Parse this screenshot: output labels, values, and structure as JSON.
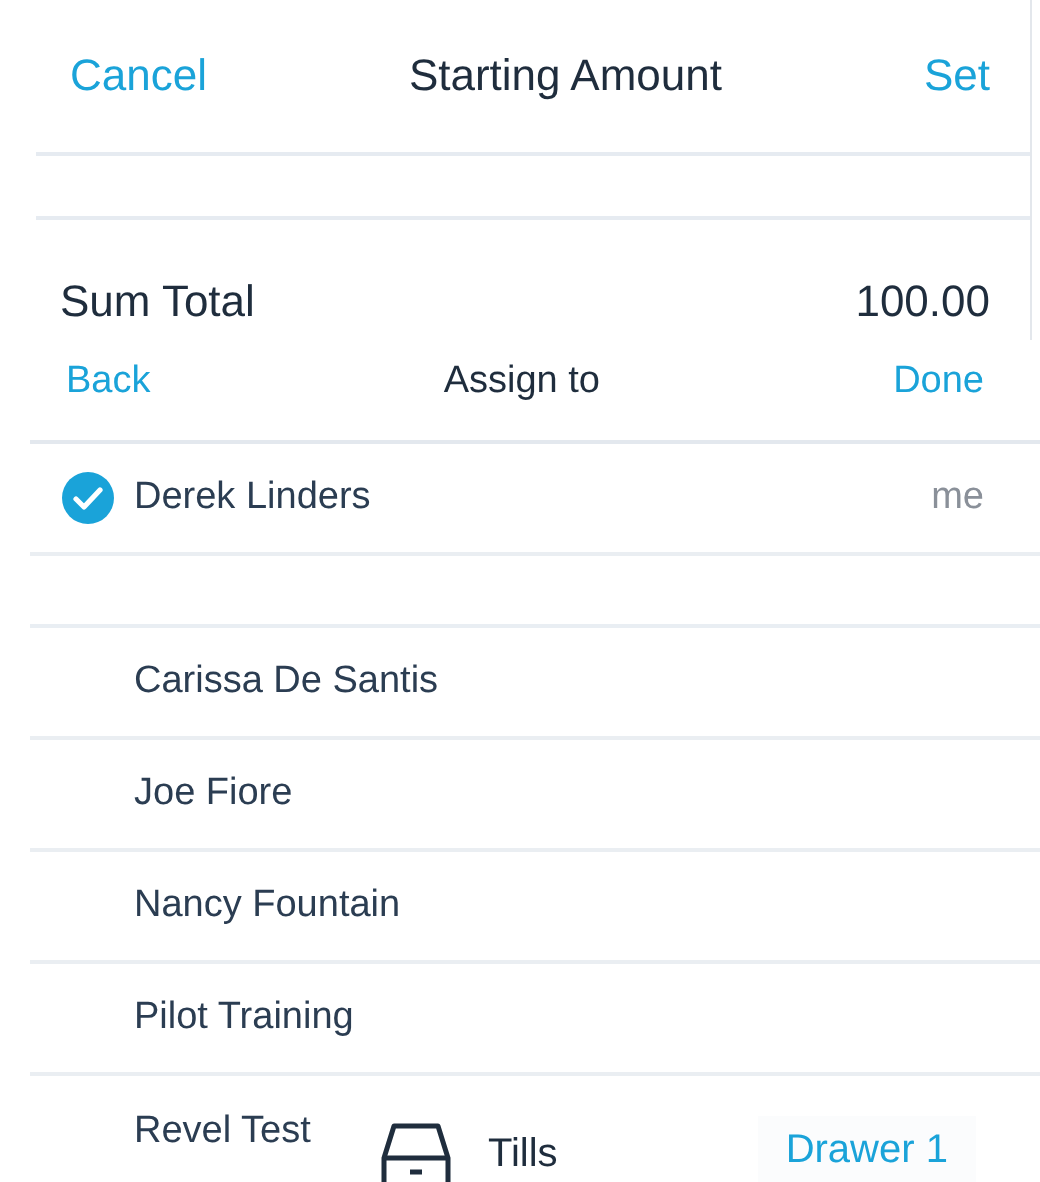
{
  "header": {
    "cancel": "Cancel",
    "title": "Starting Amount",
    "set": "Set"
  },
  "sum": {
    "label": "Sum Total",
    "value": "100.00"
  },
  "assign": {
    "back": "Back",
    "title": "Assign to",
    "done": "Done"
  },
  "sections": [
    {
      "items": [
        {
          "name": "Derek Linders",
          "note": "me",
          "selected": true
        }
      ]
    },
    {
      "items": [
        {
          "name": "Carissa De Santis",
          "selected": false
        },
        {
          "name": "Joe Fiore",
          "selected": false
        },
        {
          "name": "Nancy Fountain",
          "selected": false
        },
        {
          "name": "Pilot Training",
          "selected": false
        },
        {
          "name": "Revel Test",
          "selected": false
        }
      ]
    }
  ],
  "bottom_bar": {
    "label": "Tills",
    "drawer": "Drawer 1"
  }
}
